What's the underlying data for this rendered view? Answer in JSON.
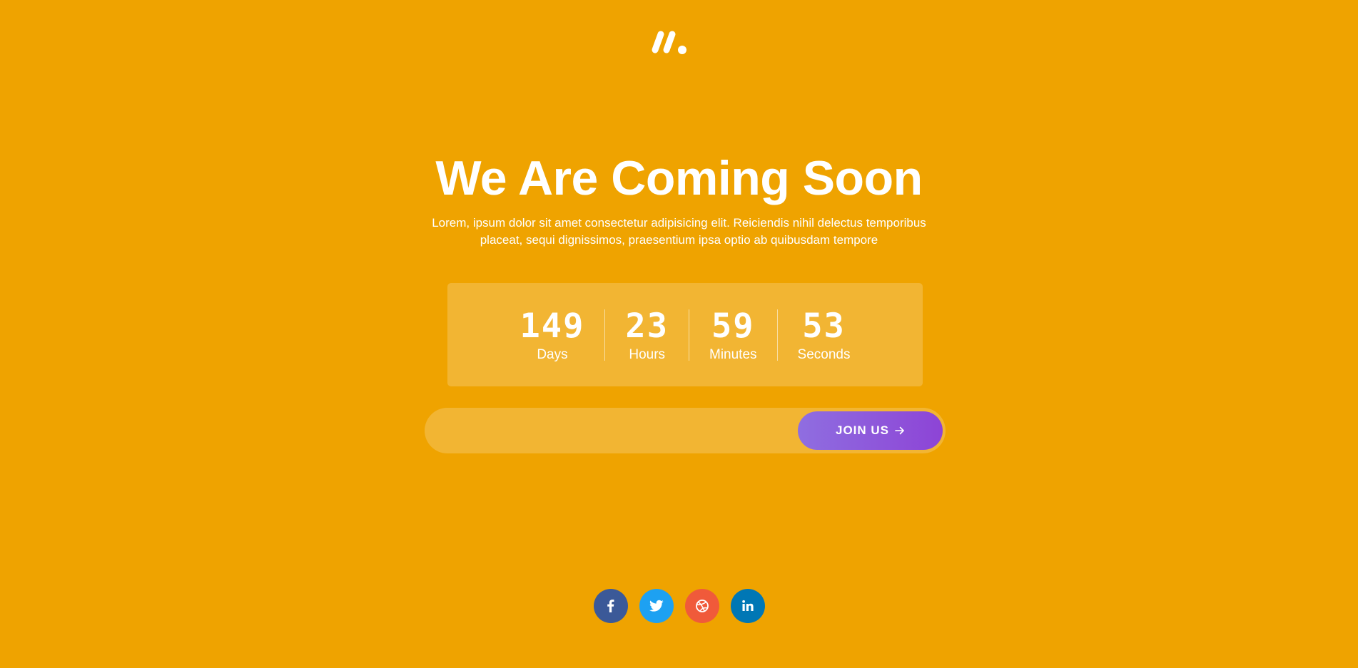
{
  "hero": {
    "title": "We Are Coming Soon",
    "description_line1": "Lorem, ipsum dolor sit amet consectetur adipisicing elit. Reiciendis nihil delectus temporibus",
    "description_line2": "placeat, sequi dignissimos, praesentium ipsa optio ab quibusdam tempore"
  },
  "countdown": {
    "days": {
      "value": "149",
      "label": "Days"
    },
    "hours": {
      "value": "23",
      "label": "Hours"
    },
    "minutes": {
      "value": "59",
      "label": "Minutes"
    },
    "seconds": {
      "value": "53",
      "label": "Seconds"
    }
  },
  "subscribe": {
    "email_value": "",
    "button_label": "JOIN US",
    "button_icon": "arrow-right-icon"
  },
  "social": [
    {
      "name": "facebook",
      "icon": "facebook-icon",
      "color": "#3b5998"
    },
    {
      "name": "twitter",
      "icon": "twitter-icon",
      "color": "#1da1f2"
    },
    {
      "name": "dribbble",
      "icon": "dribbble-icon",
      "color": "#ea4c89"
    },
    {
      "name": "linkedin",
      "icon": "linkedin-icon",
      "color": "#0077b5"
    }
  ],
  "colors": {
    "background": "#efa300",
    "button_gradient_start": "#8f6ee0",
    "button_gradient_end": "#8d44d6",
    "facebook": "#3b5998",
    "twitter": "#1da1f2",
    "dribbble": "#f05a3a",
    "linkedin": "#0077b5"
  }
}
